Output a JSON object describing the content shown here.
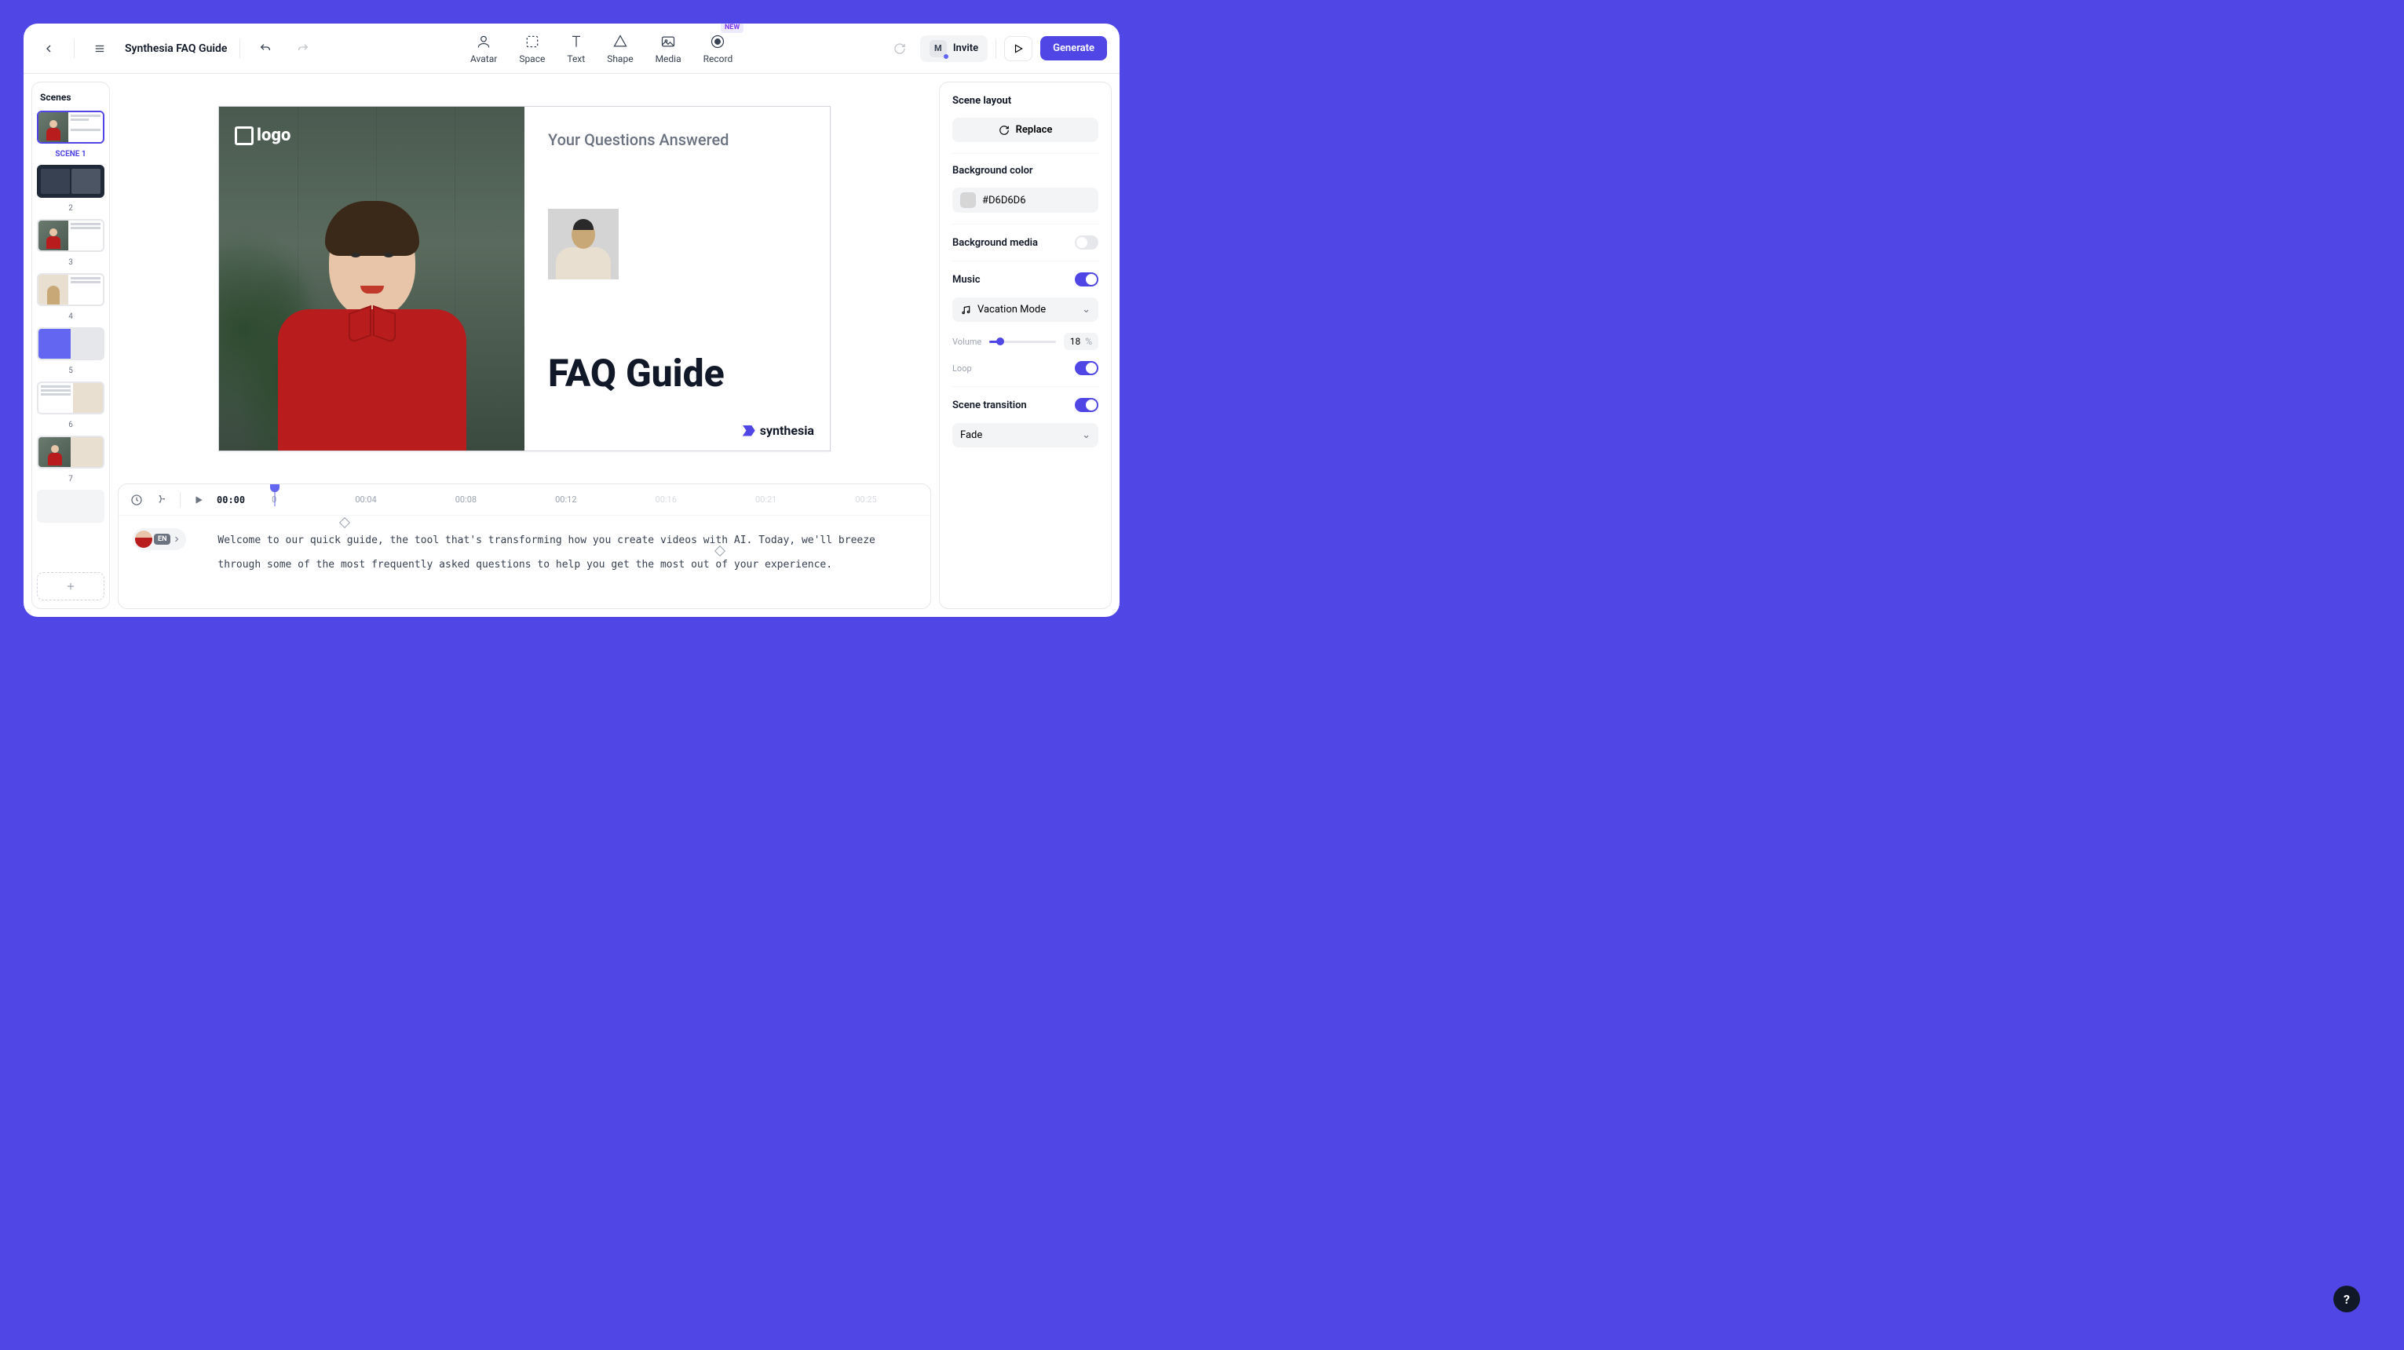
{
  "header": {
    "title": "Synthesia FAQ Guide",
    "tools": [
      {
        "label": "Avatar"
      },
      {
        "label": "Space"
      },
      {
        "label": "Text"
      },
      {
        "label": "Shape"
      },
      {
        "label": "Media"
      },
      {
        "label": "Record",
        "badge": "NEW"
      }
    ],
    "invite_label": "Invite",
    "user_initial": "M",
    "generate_label": "Generate"
  },
  "scenes": {
    "title": "Scenes",
    "items": [
      {
        "label": "SCENE 1"
      },
      {
        "label": "2"
      },
      {
        "label": "3"
      },
      {
        "label": "4"
      },
      {
        "label": "5"
      },
      {
        "label": "6"
      },
      {
        "label": "7"
      }
    ]
  },
  "canvas": {
    "logo_text": "logo",
    "subtitle": "Your Questions Answered",
    "title": "FAQ Guide",
    "brand": "synthesia"
  },
  "timeline": {
    "current": "00:00",
    "ticks": [
      "0",
      "00:04",
      "00:08",
      "00:12",
      "00:16",
      "00:21",
      "00:25"
    ],
    "lang": "EN",
    "script": "Welcome to our quick guide, the tool that's transforming how you create videos with AI. Today, we'll breeze through some of the most frequently asked questions to help you get the most out of your experience."
  },
  "right": {
    "title": "Scene layout",
    "replace_label": "Replace",
    "bg_color_label": "Background color",
    "bg_color_value": "#D6D6D6",
    "bg_media_label": "Background media",
    "music_label": "Music",
    "music_track": "Vacation Mode",
    "volume_label": "Volume",
    "volume_value": "18",
    "volume_unit": "%",
    "loop_label": "Loop",
    "transition_label": "Scene transition",
    "transition_value": "Fade"
  }
}
